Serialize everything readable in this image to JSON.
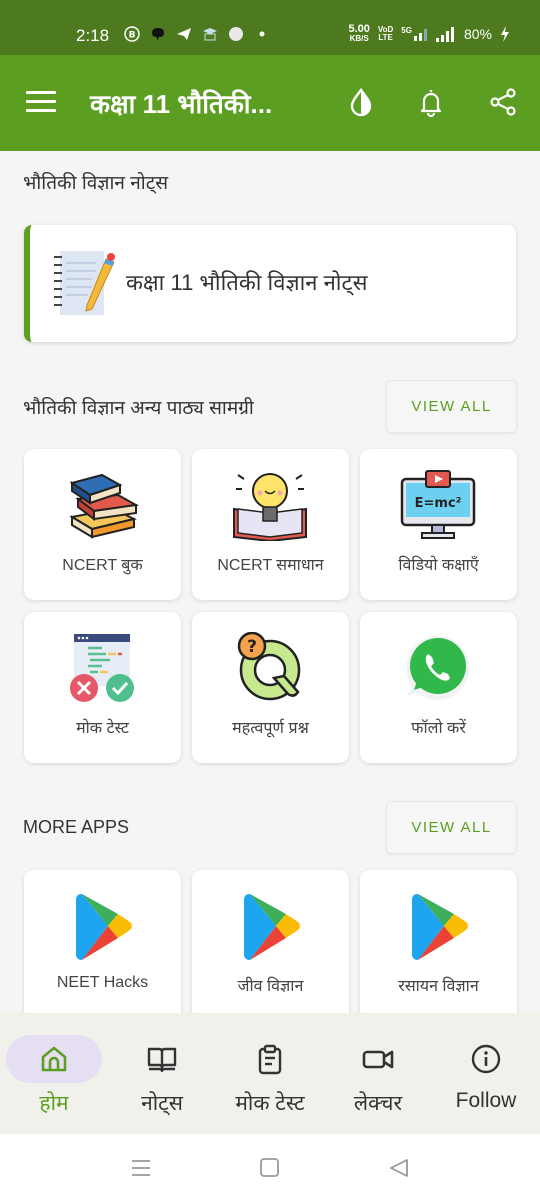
{
  "status_bar": {
    "time": "2:18",
    "net_speed_value": "5.00",
    "net_speed_unit": "KB/S",
    "volte_top": "VoD",
    "volte_bottom": "LTE",
    "network": "5G",
    "battery": "80%"
  },
  "app_bar": {
    "title": "कक्षा 11 भौतिकी...",
    "menu_icon": "hamburger-icon",
    "theme_icon": "drop-icon",
    "notification_icon": "bell-icon",
    "share_icon": "share-icon"
  },
  "notes_section": {
    "title": "भौतिकी विज्ञान नोट्स",
    "card_label": "कक्षा 11 भौतिकी विज्ञान नोट्स",
    "card_icon": "notebook-pencil-icon"
  },
  "study_material": {
    "title": "भौतिकी विज्ञान अन्य पाठ्य सामग्री",
    "view_all": "VIEW ALL",
    "tiles": [
      {
        "label": "NCERT बुक",
        "icon": "books-icon"
      },
      {
        "label": "NCERT समाधान",
        "icon": "bulb-book-icon"
      },
      {
        "label": "विडियो कक्षाएँ",
        "icon": "video-monitor-icon"
      },
      {
        "label": "मोक टेस्ट",
        "icon": "mock-test-icon"
      },
      {
        "label": "महत्वपूर्ण प्रश्न",
        "icon": "question-icon"
      },
      {
        "label": "फॉलो करें",
        "icon": "whatsapp-icon"
      }
    ]
  },
  "more_apps": {
    "title": "MORE APPS",
    "view_all": "VIEW ALL",
    "tiles": [
      {
        "label": "NEET Hacks",
        "icon": "play-store-icon"
      },
      {
        "label": "जीव विज्ञान",
        "icon": "play-store-icon"
      },
      {
        "label": "रसायन विज्ञान",
        "icon": "play-store-icon"
      }
    ]
  },
  "bottom_nav": {
    "items": [
      {
        "label": "होम",
        "icon": "home-icon",
        "active": true
      },
      {
        "label": "नोट्स",
        "icon": "book-open-icon",
        "active": false
      },
      {
        "label": "मोक टेस्ट",
        "icon": "clipboard-icon",
        "active": false
      },
      {
        "label": "लेक्चर",
        "icon": "video-camera-icon",
        "active": false
      },
      {
        "label": "Follow",
        "icon": "info-icon",
        "active": false
      }
    ]
  },
  "colors": {
    "status_bar": "#4d7a1f",
    "primary": "#5c9e21",
    "active_pill": "#e6dff3",
    "background": "#f5f5f5"
  }
}
